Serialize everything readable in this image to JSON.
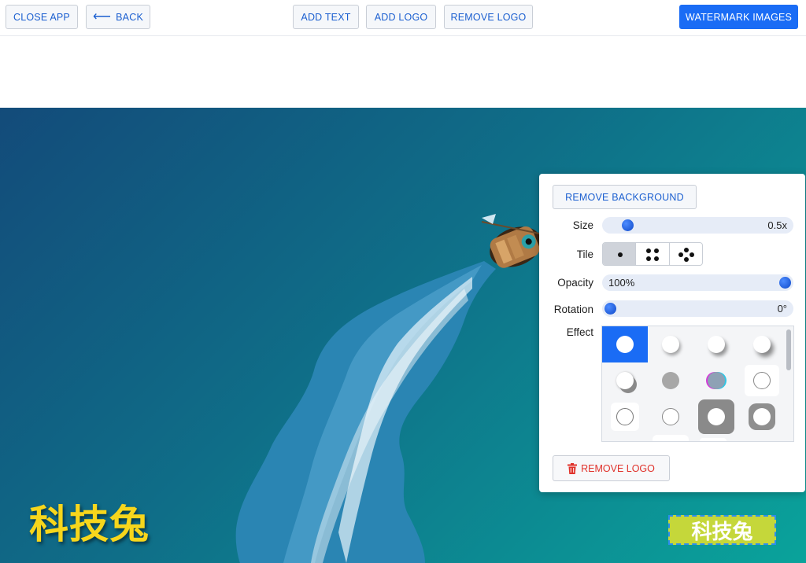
{
  "toolbar": {
    "close_app": "CLOSE APP",
    "back": "BACK",
    "back_arrow": "⟵",
    "add_text": "ADD TEXT",
    "add_logo": "ADD LOGO",
    "remove_logo": "REMOVE LOGO",
    "watermark_images": "WATERMARK IMAGES"
  },
  "canvas": {
    "text_watermark": "科技兔",
    "logo_watermark": "科技兔"
  },
  "panel": {
    "remove_background": "REMOVE BACKGROUND",
    "size_label": "Size",
    "size_value": "0.5x",
    "size_level": 0.1,
    "tile_label": "Tile",
    "tile_options": [
      "single",
      "four-grid",
      "five-dot"
    ],
    "tile_selected": "single",
    "opacity_label": "Opacity",
    "opacity_value": "100%",
    "opacity_level": 1.0,
    "rotation_label": "Rotation",
    "rotation_value": "0°",
    "rotation_level": 0.0,
    "effect_label": "Effect",
    "effect_selected_index": 0,
    "remove_logo": "REMOVE LOGO",
    "trash_icon": "trash-icon"
  },
  "colors": {
    "accent": "#1a6cf5",
    "danger": "#e0322b",
    "watermark_text": "#f7d61c",
    "logo_bg": "#c5d73a"
  }
}
